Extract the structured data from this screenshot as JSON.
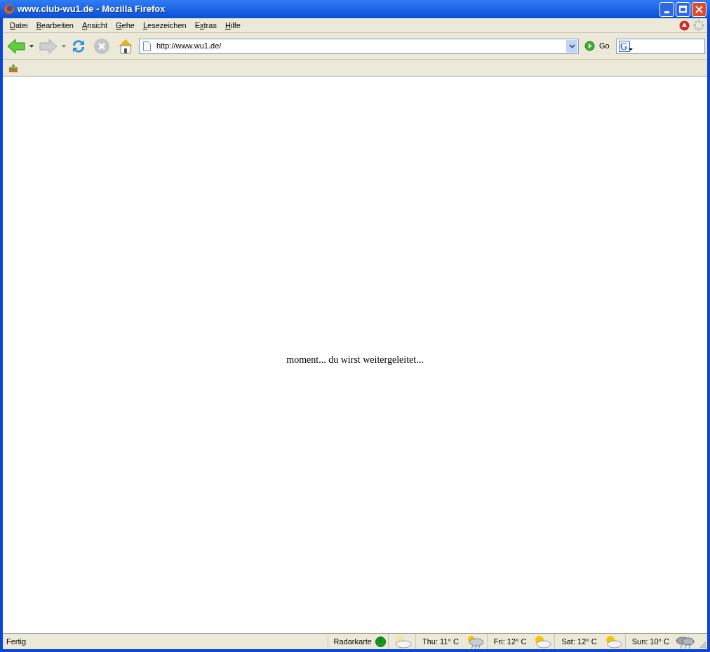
{
  "window": {
    "title": "www.club-wu1.de - Mozilla Firefox"
  },
  "menu": [
    {
      "key": "D",
      "post": "atei"
    },
    {
      "key": "B",
      "post": "earbeiten"
    },
    {
      "key": "A",
      "post": "nsicht"
    },
    {
      "key": "G",
      "post": "ehe"
    },
    {
      "key": "L",
      "post": "esezeichen"
    },
    {
      "pre": "E",
      "key": "x",
      "post": "tras"
    },
    {
      "key": "H",
      "post": "ilfe"
    }
  ],
  "search_engine_glyph": "G",
  "toolbar": {
    "back_disabled": false,
    "forward_disabled": true,
    "stop_disabled": true,
    "address": "http://www.wu1.de/",
    "go_label": "Go"
  },
  "page": {
    "message": "moment... du wirst weitergeleitet..."
  },
  "status_bar": {
    "status": "Fertig",
    "radar_label": "Radarkarte",
    "forecast": [
      {
        "label": "Thu: 11° C",
        "kind": "rain"
      },
      {
        "label": "Fri: 12° C",
        "kind": "sun"
      },
      {
        "label": "Sat: 12° C",
        "kind": "sun"
      },
      {
        "label": "Sun: 10° C",
        "kind": "storm"
      }
    ]
  }
}
